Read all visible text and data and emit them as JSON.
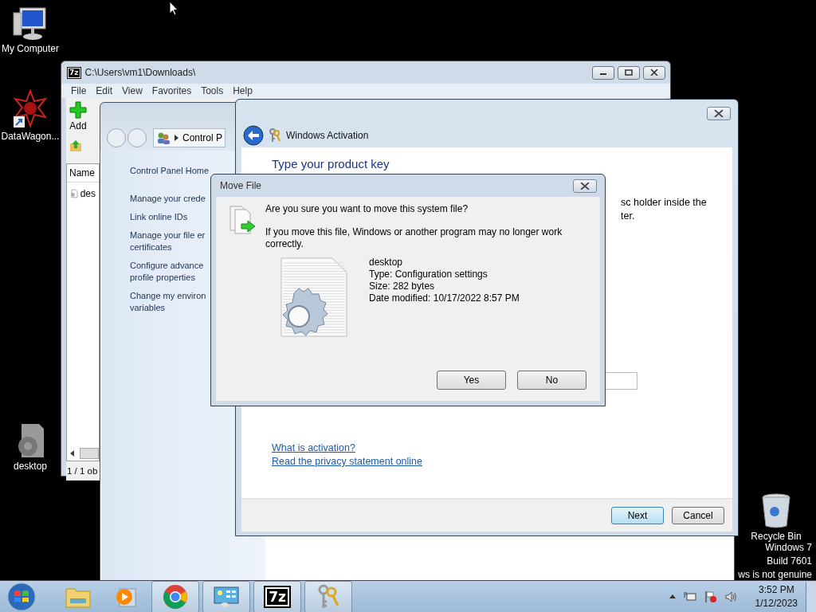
{
  "desktop_icons": [
    {
      "kind": "computer",
      "label": "My Computer"
    },
    {
      "kind": "shortcut",
      "label": "DataWagon..."
    },
    {
      "kind": "config",
      "label": "desktop"
    },
    {
      "kind": "bin",
      "label": "Recycle Bin"
    }
  ],
  "zip_window": {
    "icon_text": "7z",
    "title": "C:\\Users\\vm1\\Downloads\\",
    "menu": [
      "File",
      "Edit",
      "View",
      "Favorites",
      "Tools",
      "Help"
    ],
    "toolbar": [
      "Add"
    ],
    "column": "Name",
    "file": "des",
    "status": "1 / 1 ob"
  },
  "control_panel": {
    "address": "Control P",
    "links": [
      {
        "lines": [
          "Control Panel Home"
        ]
      },
      {
        "lines": [
          "Manage your crede"
        ]
      },
      {
        "lines": [
          "Link online IDs"
        ]
      },
      {
        "lines": [
          "Manage your file er",
          "certificates"
        ]
      },
      {
        "lines": [
          "Configure advance",
          "profile properties"
        ]
      },
      {
        "lines": [
          "Change my environ",
          "variables"
        ]
      }
    ]
  },
  "activation": {
    "title": "Windows Activation",
    "heading": "Type your product key",
    "text_lines": [
      "sc holder inside the",
      "ter."
    ],
    "links": [
      "What is activation?",
      "Read the privacy statement online"
    ],
    "buttons": [
      {
        "label": "Next",
        "default": true
      },
      {
        "label": "Cancel",
        "default": false
      }
    ]
  },
  "dialog": {
    "title": "Move File",
    "question": "Are you sure you want to move this system file?",
    "warning": "If you move this file, Windows or another program may no longer work correctly.",
    "file_name": "desktop",
    "details": [
      "Type: Configuration settings",
      "Size: 282 bytes",
      "Date modified: 10/17/2022 8:57 PM"
    ],
    "buttons": [
      "Yes",
      "No"
    ]
  },
  "os_notice": [
    "Windows 7",
    "Build 7601",
    "ws is not genuine"
  ],
  "taskbar": {
    "apps": [
      {
        "kind": "explorer",
        "open": false
      },
      {
        "kind": "media",
        "open": false
      },
      {
        "kind": "chrome",
        "open": true
      },
      {
        "kind": "control",
        "open": true
      },
      {
        "kind": "zip",
        "open": true,
        "label": "7z"
      },
      {
        "kind": "keys",
        "open": true
      }
    ],
    "time": "3:52 PM",
    "date": "1/12/2023"
  }
}
